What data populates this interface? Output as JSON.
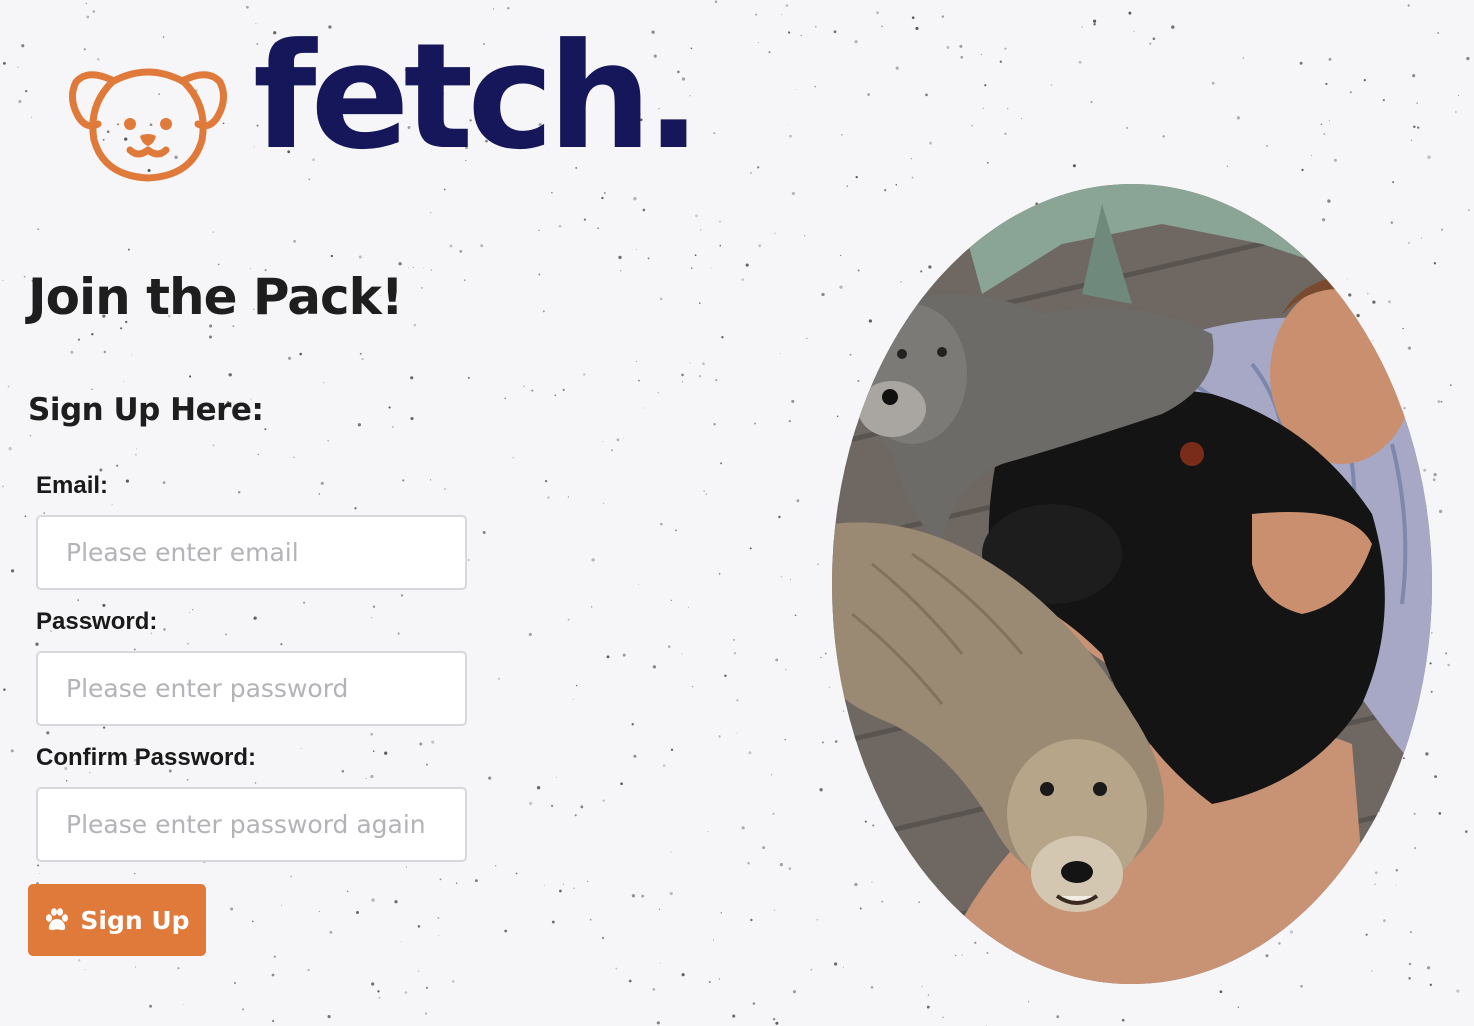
{
  "brand": {
    "logo_icon": "dog-face-icon",
    "wordmark": "fetch.",
    "primary_color": "#16175a",
    "accent_color": "#e07a3a"
  },
  "page": {
    "title": "Join the Pack!",
    "form_heading": "Sign Up Here:"
  },
  "form": {
    "email": {
      "label": "Email:",
      "placeholder": "Please enter email",
      "value": ""
    },
    "password": {
      "label": "Password:",
      "placeholder": "Please enter password",
      "value": ""
    },
    "confirm_password": {
      "label": "Confirm Password:",
      "placeholder": "Please enter password again",
      "value": ""
    },
    "submit": {
      "label": "Sign Up",
      "icon": "paw-icon"
    }
  },
  "hero_image": {
    "icon": "dogs-with-owner-photo"
  },
  "background": {
    "color": "#f6f6f8",
    "texture": "speckled"
  }
}
